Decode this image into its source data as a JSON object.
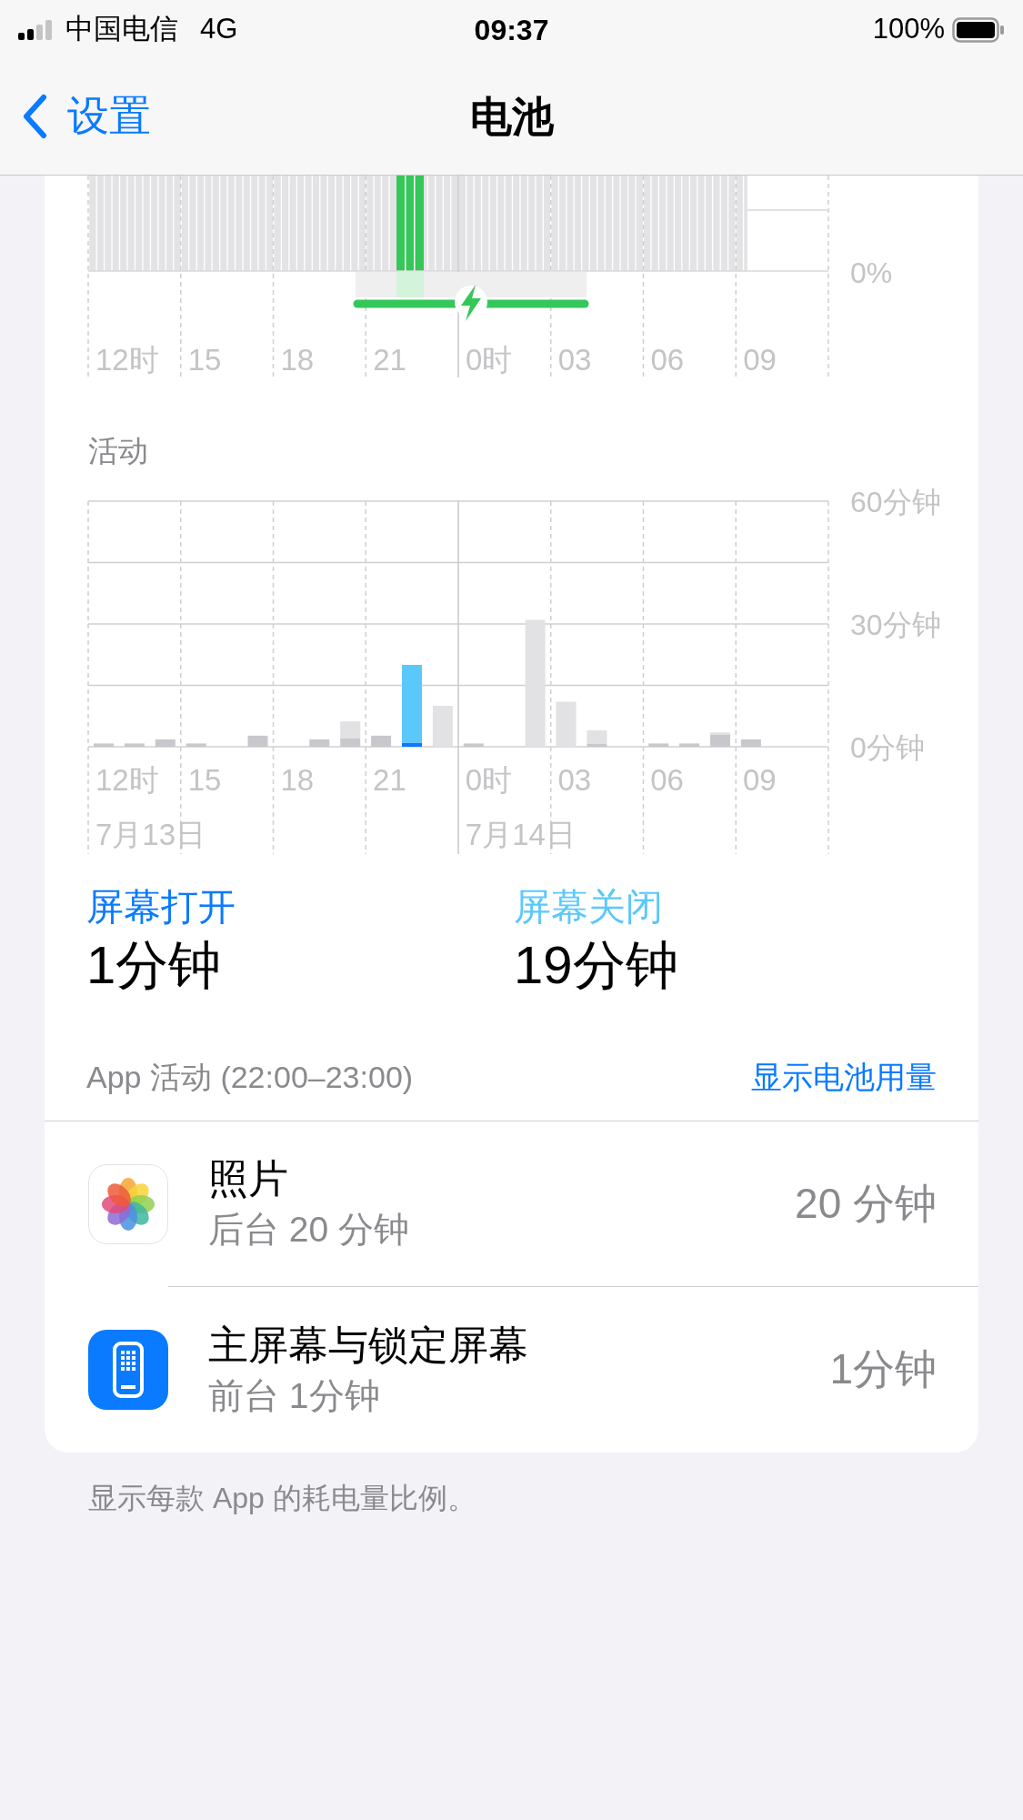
{
  "status_bar": {
    "carrier": "中国电信",
    "network": "4G",
    "time": "09:37",
    "battery": "100%"
  },
  "nav": {
    "back": "设置",
    "title": "电池"
  },
  "battery_chart": {
    "y_tick": "0%",
    "x_labels": [
      "12时",
      "15",
      "18",
      "21",
      "0时",
      "03",
      "06",
      "09"
    ],
    "charging": true
  },
  "activity": {
    "title": "活动",
    "date_labels": [
      "7月13日",
      "7月14日"
    ],
    "chart_data": {
      "type": "bar",
      "stacked": true,
      "grid": true,
      "categories": [
        "12时",
        null,
        null,
        "15",
        null,
        null,
        "18",
        null,
        null,
        "21",
        null,
        null,
        "0时",
        null,
        null,
        "03",
        null,
        null,
        "06",
        null,
        null,
        "09",
        null,
        null
      ],
      "series": [
        {
          "color": "#c8c8cc",
          "values": [
            0.8,
            0.8,
            1.8,
            0.8,
            0,
            2.7,
            0,
            1.8,
            2,
            2.7,
            0,
            0,
            0.8,
            0,
            0,
            0,
            0.8,
            0,
            0.8,
            0.8,
            3,
            1.8,
            0,
            0
          ]
        },
        {
          "color": "#e2e2e4",
          "values": [
            0,
            0,
            0,
            0,
            0,
            0,
            0,
            0,
            4.2,
            0,
            0,
            10,
            0,
            0,
            31,
            11,
            3.2,
            0,
            0,
            0,
            0.5,
            0,
            0,
            0
          ]
        },
        {
          "color": "#0a7aff",
          "values": [
            0,
            0,
            0,
            0,
            0,
            0,
            0,
            0,
            0,
            0,
            1,
            0,
            0,
            0,
            0,
            0,
            0,
            0,
            0,
            0,
            0,
            0,
            0,
            0
          ]
        },
        {
          "color": "#5ac8fa",
          "values": [
            0,
            0,
            0,
            0,
            0,
            0,
            0,
            0,
            0,
            0,
            19,
            0,
            0,
            0,
            0,
            0,
            0,
            0,
            0,
            0,
            0,
            0,
            0,
            0
          ]
        }
      ],
      "ylim": [
        0,
        60
      ],
      "yticks": [
        {
          "value": 0,
          "label": "0分钟"
        },
        {
          "value": 30,
          "label": "30分钟"
        },
        {
          "value": 60,
          "label": "60分钟"
        }
      ]
    }
  },
  "screen_stats": [
    {
      "label": "屏幕打开",
      "value": "1分钟",
      "color": "#0a7aff"
    },
    {
      "label": "屏幕关闭",
      "value": "19分钟",
      "color": "#5ac8fa"
    }
  ],
  "app_activity": {
    "title": "App 活动 (22:00–23:00)",
    "link": "显示电池用量",
    "apps": [
      {
        "kind": "photos",
        "name": "照片",
        "detail": "后台 20 分钟",
        "time": "20 分钟"
      },
      {
        "kind": "home_screen",
        "name": "主屏幕与锁定屏幕",
        "detail": "前台 1分钟",
        "time": "1分钟"
      }
    ]
  },
  "footer": "显示每款 App 的耗电量比例。"
}
